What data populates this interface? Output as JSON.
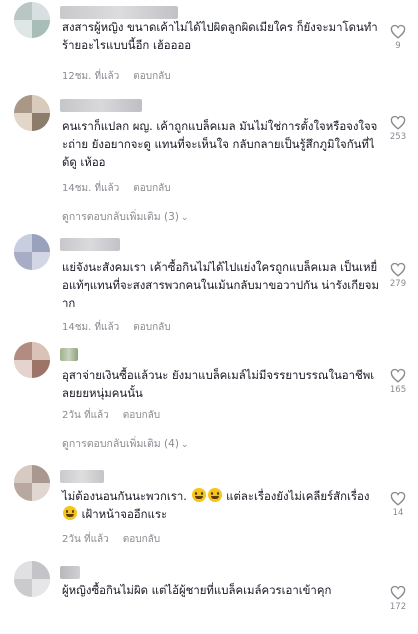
{
  "comments": [
    {
      "text": "สงสารผู้หญิง ขนาดเค้าไม่ได้ไปผิดลูกผิดเมียใคร ก็ยังจะมาโดนทำร้ายอะไรแบบนี้อีก เฮ้ออออ",
      "time": "12ชม. ที่แล้ว",
      "reply_label": "ตอบกลับ",
      "likes": "9"
    },
    {
      "text": "คนเราก็แปลก ผญ. เค้าถูกแบล็คเมล มันไม่ใช่การตั้งใจหรือจงใจจะถ่าย ยังอยากจะดู แทนที่จะเห็นใจ กลับกลายเป็นรู้สึกภูมิใจกันที่ได้ดู เห้ออ",
      "time": "14ชม. ที่แล้ว",
      "reply_label": "ตอบกลับ",
      "likes": "253",
      "view_more": "ดูการตอบกลับเพิ่มเติม (3)"
    },
    {
      "text": "แย่จังนะสังคมเรา เค้าซื้อกินไม่ได้ไปแย่งใครถูกแบล็คเมล เป็นเหยื่อแท้ๆแทนที่จะสงสารพวกคนในเม้นกลับมาขอวาปกัน น่ารังเกียจมาก",
      "time": "14ชม. ที่แล้ว",
      "reply_label": "ตอบกลับ",
      "likes": "279"
    },
    {
      "text": "อุสาจ่ายเงินซื้อแล้วนะ ยังมาแบล็คเมล์ไม่มีจรรยาบรรณในอาชีพเลยยยหนุ่มคนนั้น",
      "time": "2วัน ที่แล้ว",
      "reply_label": "ตอบกลับ",
      "likes": "165",
      "view_more": "ดูการตอบกลับเพิ่มเติม (4)"
    },
    {
      "text_a": "ไม่ต้องนอนกันนะพวกเรา.",
      "text_b": " แต่ละเรื่องยังไม่เคลียร์สักเรื่อง",
      "text_c": " เฝ้าหน้าจออีกแระ",
      "time": "2วัน ที่แล้ว",
      "reply_label": "ตอบกลับ",
      "likes": "14"
    },
    {
      "text": "ผู้หญิงซื้อกินไม่ผิด แต่ไอ้ผู้ชายที่แบล็คเมล์ควรเอาเข้าคุก",
      "likes": "172"
    }
  ],
  "icons": {
    "like": "heart-outline-icon",
    "chevron": "chevron-down-icon",
    "emoji": "grinning-face-emoji"
  },
  "colors": {
    "text": "#161823",
    "muted": "#8a8b91",
    "background": "#ffffff"
  }
}
